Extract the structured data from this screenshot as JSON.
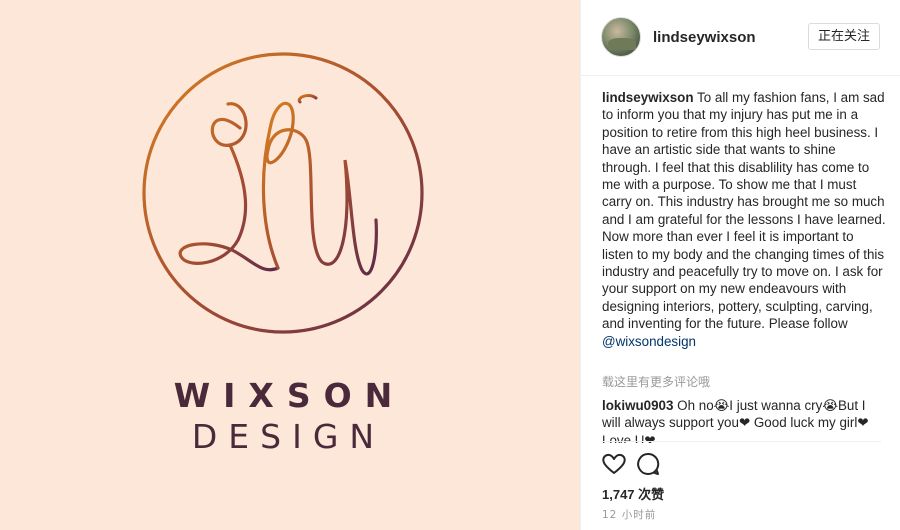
{
  "post": {
    "image": {
      "brand_line1": "WIXSON",
      "brand_line2": "DESIGN",
      "monogram_icon": "lw-monogram-circle-logo",
      "colors": {
        "background": "#fde7d9",
        "ring_start": "#d57a1d",
        "ring_end": "#5a2a4a",
        "text": "#4a2a3a"
      }
    },
    "header": {
      "username": "lindseywixson",
      "follow_label": "正在关注"
    },
    "caption": {
      "username": "lindseywixson",
      "text": " To all my fashion fans, I am sad to inform you that my injury has put me in a position to retire from this high heel business. I have an artistic side that wants to shine through. I feel that this disablility has come to me with a purpose. To show me that I must carry on. This industry has brought me so much and I am grateful for the lessons I have learned. Now more than ever I feel it is important to listen to my body and the changing times of this industry and peacefully try to move on. I ask for your support on my new endeavours with designing interiors, pottery, sculpting, carving, and inventing for the future. Please follow ",
      "mention": "@wixsondesign"
    },
    "more_comments_label": "载这里有更多评论哦",
    "comments": [
      {
        "username": "lokiwu0903",
        "text": " Oh no😭I just wanna cry😭But I will always support you❤ Good luck my girl❤Love U❤"
      }
    ],
    "actions": {
      "like_icon": "heart-icon",
      "comment_icon": "comment-icon"
    },
    "likes": "1,747 次赞",
    "timestamp": "12 小时前"
  }
}
